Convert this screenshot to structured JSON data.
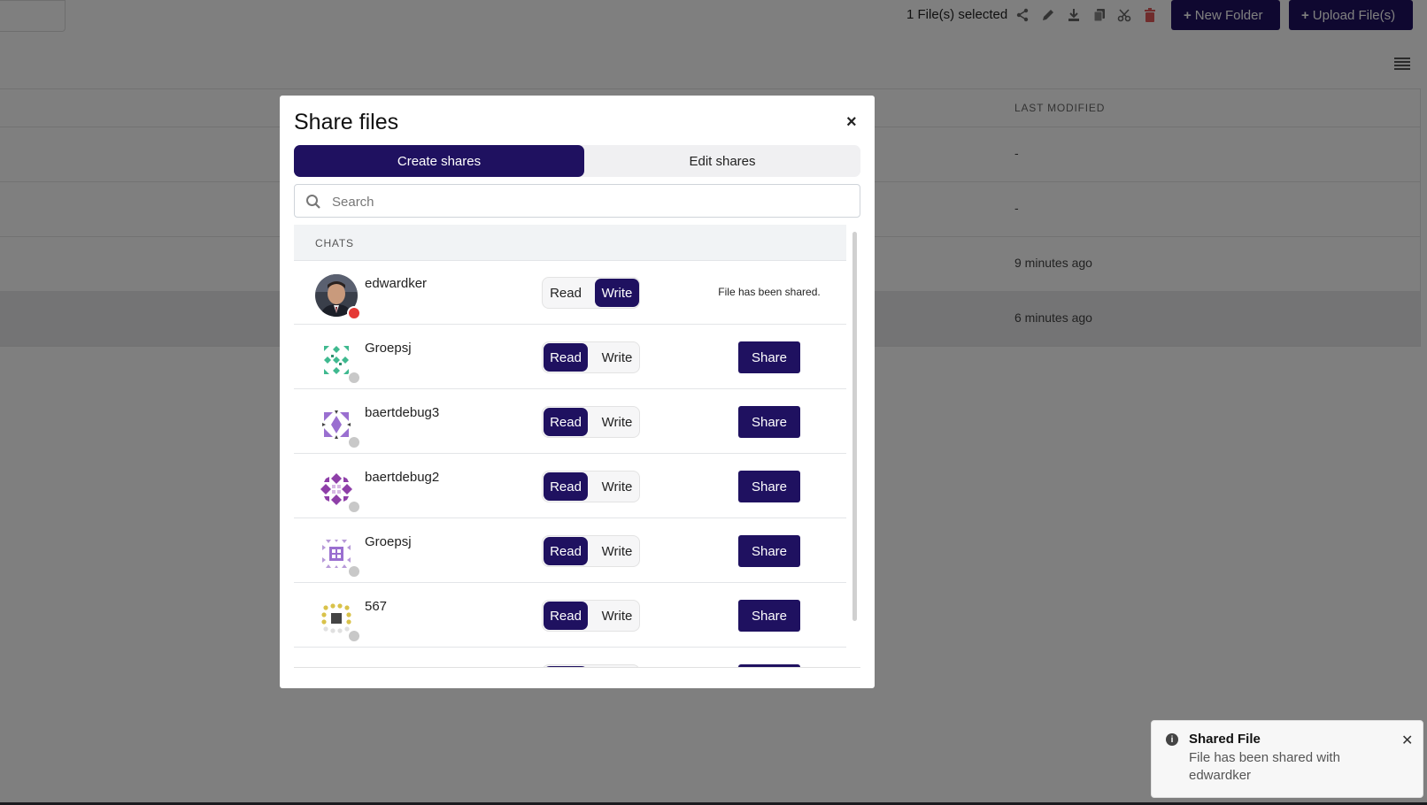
{
  "topbar": {
    "selection_text": "1 File(s) selected",
    "new_folder_label": "New Folder",
    "upload_label": "Upload File(s)"
  },
  "table": {
    "column_last_modified": "LAST MODIFIED",
    "rows": [
      {
        "last_modified": "-"
      },
      {
        "last_modified": "-"
      },
      {
        "last_modified": "9 minutes ago"
      },
      {
        "last_modified": "6 minutes ago",
        "selected": true
      }
    ]
  },
  "modal": {
    "title": "Share files",
    "close_glyph": "×",
    "tabs": {
      "create": "Create shares",
      "edit": "Edit shares",
      "active": "create"
    },
    "search_placeholder": "Search",
    "section_label": "CHATS",
    "read_label": "Read",
    "write_label": "Write",
    "share_label": "Share",
    "chats": [
      {
        "name": "edwardker",
        "status": "online",
        "permission": "write",
        "shared": true,
        "shared_text": "File has been shared."
      },
      {
        "name": "Groepsj",
        "status": "offline",
        "permission": "read",
        "shared": false
      },
      {
        "name": "baertdebug3",
        "status": "offline",
        "permission": "read",
        "shared": false
      },
      {
        "name": "baertdebug2",
        "status": "offline",
        "permission": "read",
        "shared": false
      },
      {
        "name": "Groepsj",
        "status": "offline",
        "permission": "read",
        "shared": false
      },
      {
        "name": "567",
        "status": "offline",
        "permission": "read",
        "shared": false
      }
    ]
  },
  "toast": {
    "title": "Shared File",
    "message": "File has been shared with edwardker",
    "icon": "info-icon"
  },
  "colors": {
    "primary": "#1f1160",
    "delete_icon": "#e05858",
    "status_online": "#e53935",
    "status_offline": "#c8c8c8"
  }
}
